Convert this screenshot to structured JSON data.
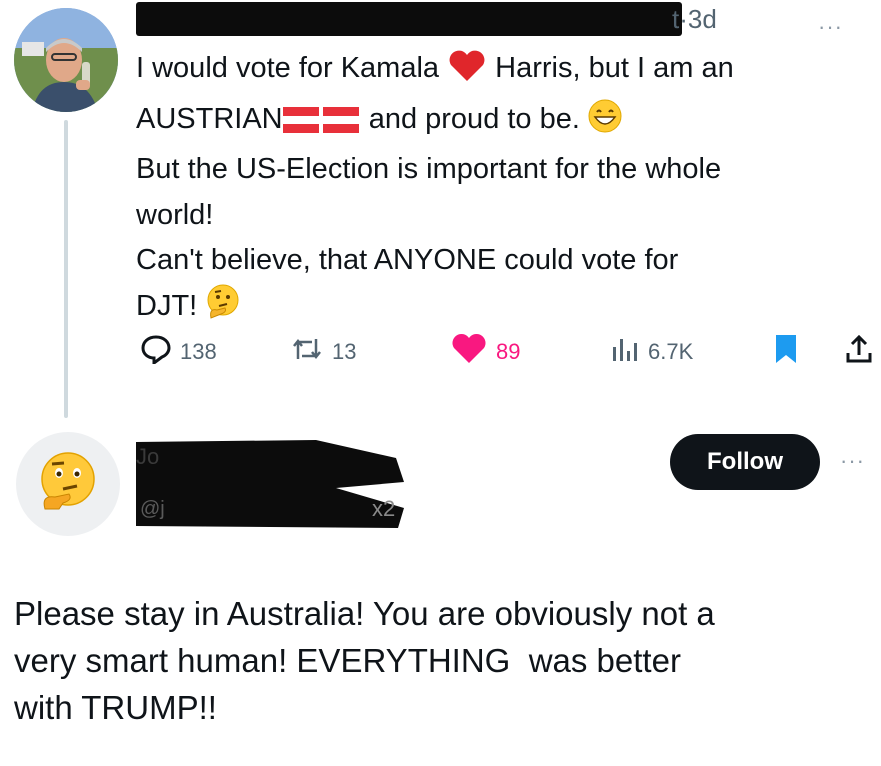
{
  "post": {
    "timestamp": "3d",
    "handle_fragment": "t",
    "more_label": "···",
    "lines": [
      {
        "pre": "I would vote for Kamala",
        "post": "Harris, but I am an"
      },
      {
        "pre": "AUSTRIAN",
        "post": "and proud to be."
      },
      {
        "text": "But the US-Election is important for the whole"
      },
      {
        "text": "world!"
      },
      {
        "text": "Can't believe, that ANYONE could vote for"
      },
      {
        "pre": "DJT!"
      }
    ],
    "emojis": [
      "red-heart",
      "austria-flag",
      "austria-flag",
      "grinning-face",
      "thinking-face"
    ],
    "actions": {
      "replies": "138",
      "reposts": "13",
      "likes": "89",
      "views": "6.7K"
    },
    "colors": {
      "like": "#f91880",
      "bookmark": "#1d9bf0",
      "muted": "#536471"
    }
  },
  "reply": {
    "name_fragment": "Jo",
    "handle_fragment": "@j",
    "handle_suffix": "x2",
    "follow_label": "Follow",
    "more_label": "···",
    "avatar_emoji": "thinking-face",
    "lines": [
      "Please stay in Australia! You are obviously not a",
      "very smart human! EVERYTHING  was better",
      "with TRUMP!!"
    ]
  }
}
